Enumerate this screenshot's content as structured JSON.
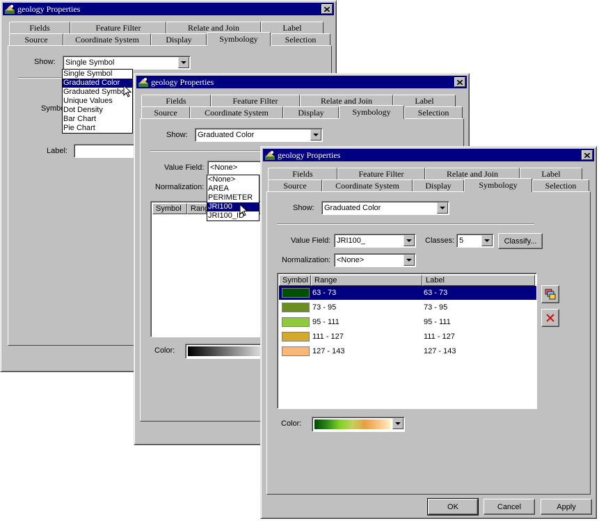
{
  "colors": {
    "titlebar": "#000080",
    "face": "#c0c0c0",
    "selection": "#000080"
  },
  "win1": {
    "title": "geology Properties",
    "tabs_back": [
      "Fields",
      "Feature Filter",
      "Relate and Join",
      "Label"
    ],
    "tabs_front": [
      "Source",
      "Coordinate System",
      "Display",
      "Symbology",
      "Selection"
    ],
    "show_label": "Show:",
    "show_value": "Single Symbol",
    "show_options": [
      "Single Symbol",
      "Graduated Color",
      "Graduated Symbol",
      "Unique Values",
      "Dot Density",
      "Bar Chart",
      "Pie Chart"
    ],
    "symbol_label": "Symbol",
    "label_label": "Label:"
  },
  "win2": {
    "title": "geology Properties",
    "tabs_back": [
      "Fields",
      "Feature Filter",
      "Relate and Join",
      "Label"
    ],
    "tabs_front": [
      "Source",
      "Coordinate System",
      "Display",
      "Symbology",
      "Selection"
    ],
    "show_label": "Show:",
    "show_value": "Graduated Color",
    "value_field_label": "Value Field:",
    "value_field_value": "<None>",
    "field_options": [
      "<None>",
      "AREA",
      "PERIMETER",
      "JRI100",
      "JRI100_ID"
    ],
    "normalization_label": "Normalization:",
    "col_symbol": "Symbol",
    "col_range": "Range",
    "color_label": "Color:"
  },
  "win3": {
    "title": "geology Properties",
    "tabs_back": [
      "Fields",
      "Feature Filter",
      "Relate and Join",
      "Label"
    ],
    "tabs_front": [
      "Source",
      "Coordinate System",
      "Display",
      "Symbology",
      "Selection"
    ],
    "show_label": "Show:",
    "show_value": "Graduated Color",
    "value_field_label": "Value Field:",
    "value_field_value": "JRI100_",
    "classes_label": "Classes:",
    "classes_value": "5",
    "classify_button": "Classify...",
    "normalization_label": "Normalization:",
    "normalization_value": "<None>",
    "columns": [
      "Symbol",
      "Range",
      "Label"
    ],
    "rows": [
      {
        "color": "#005000",
        "range": "63 - 73",
        "label": "63 - 73"
      },
      {
        "color": "#6b8e23",
        "range": "73 - 95",
        "label": "73 - 95"
      },
      {
        "color": "#8fca3a",
        "range": "95 - 111",
        "label": "95 - 111"
      },
      {
        "color": "#d4aa2c",
        "range": "111 - 127",
        "label": "111 - 127"
      },
      {
        "color": "#f8b878",
        "range": "127 - 143",
        "label": "127 - 143"
      }
    ],
    "color_label": "Color:",
    "ok_button": "OK",
    "cancel_button": "Cancel",
    "apply_button": "Apply"
  }
}
